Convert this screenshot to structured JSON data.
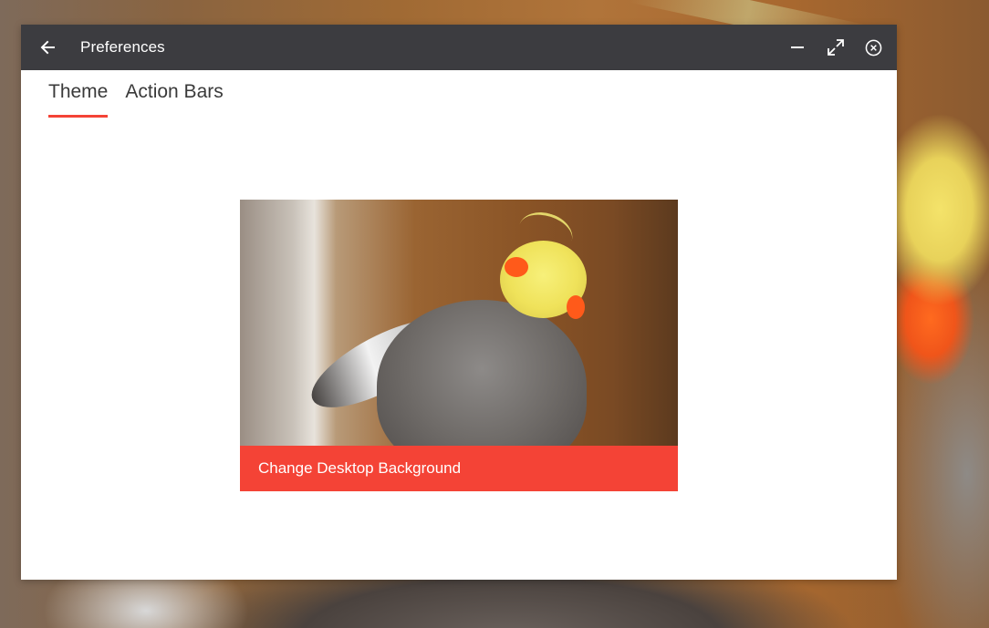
{
  "window": {
    "title": "Preferences"
  },
  "titlebar": {
    "back_icon": "arrow-left-icon",
    "minimize_icon": "minimize-icon",
    "maximize_icon": "maximize-icon",
    "close_icon": "close-circle-icon",
    "background_color": "#3c3c40"
  },
  "tabs": [
    {
      "label": "Theme",
      "active": true
    },
    {
      "label": "Action Bars",
      "active": false
    }
  ],
  "theme": {
    "background_card": {
      "label": "Change Desktop Background",
      "accent_color": "#f44336"
    }
  },
  "colors": {
    "accent": "#f44336",
    "titlebar": "#3c3c40",
    "window_bg": "#ffffff"
  }
}
